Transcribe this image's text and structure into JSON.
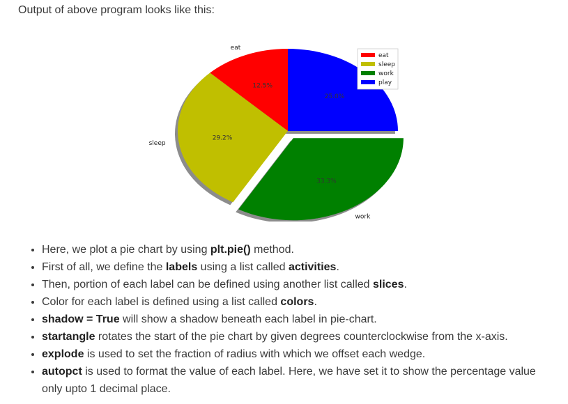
{
  "intro": "Output of above program looks like this:",
  "chart_data": {
    "type": "pie",
    "labels": [
      "eat",
      "sleep",
      "work",
      "play"
    ],
    "values": [
      12.5,
      29.2,
      33.3,
      25.0
    ],
    "pct_labels": [
      "12.5%",
      "29.2%",
      "33.3%",
      "25.0%"
    ],
    "colors": [
      "#ff0000",
      "#c0bf00",
      "#008000",
      "#0000ff"
    ],
    "startangle_deg": 90,
    "explode": [
      0,
      0,
      0.1,
      0
    ],
    "shadow": true,
    "legend": {
      "placement": "upper-right",
      "entries": [
        "eat",
        "sleep",
        "work",
        "play"
      ]
    }
  },
  "notes": [
    {
      "pre": "Here, we plot a pie chart by using ",
      "b": "plt.pie()",
      "post": " method."
    },
    {
      "pre": "First of all, we define the ",
      "b": "labels",
      "mid": " using a list called ",
      "b2": "activities",
      "post": "."
    },
    {
      "pre": "Then, portion of each label can be defined using another list called ",
      "b": "slices",
      "post": "."
    },
    {
      "pre": "Color for each label is defined using a list called ",
      "b": "colors",
      "post": "."
    },
    {
      "pre": "",
      "b": "shadow = True",
      "post": " will show a shadow beneath each label in pie-chart."
    },
    {
      "pre": "",
      "b": "startangle",
      "post": " rotates the start of the pie chart by given degrees counterclockwise from the x-axis."
    },
    {
      "pre": "",
      "b": "explode",
      "post": " is used to set the fraction of radius with which we offset each wedge."
    },
    {
      "pre": "",
      "b": "autopct",
      "post": " is used to format the value of each label. Here, we have set it to show the percentage value only upto 1 decimal place."
    }
  ]
}
